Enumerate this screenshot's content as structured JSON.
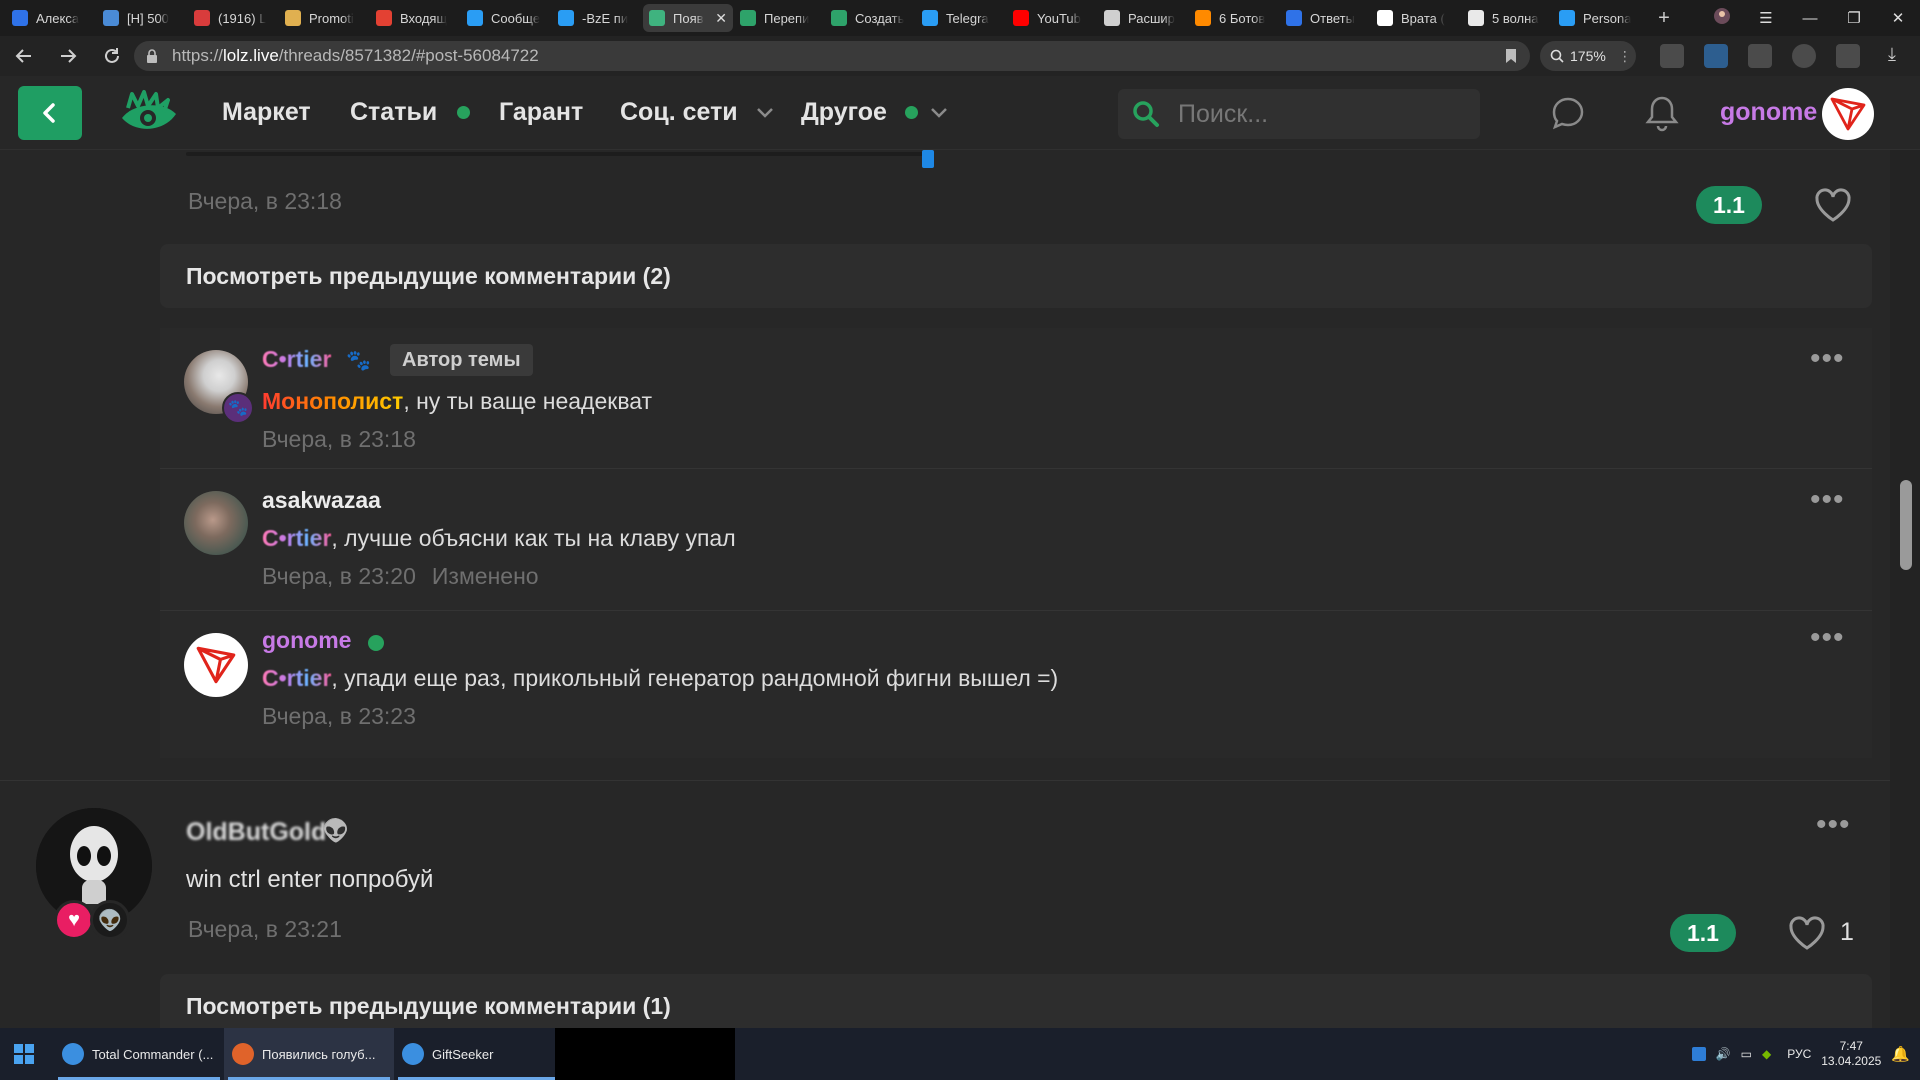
{
  "browser": {
    "tabs": [
      {
        "title": "Алекса",
        "color": "#2f72e8"
      },
      {
        "title": "[H] 500",
        "color": "#4a8bd6"
      },
      {
        "title": "(1916) L",
        "color": "#d93c3c"
      },
      {
        "title": "Promoti",
        "color": "#e0b050"
      },
      {
        "title": "Входящ",
        "color": "#e34133"
      },
      {
        "title": "Сообще",
        "color": "#2a9df4"
      },
      {
        "title": "-BzE пи",
        "color": "#2a9df4"
      },
      {
        "title": "Появ",
        "color": "#3fb37f",
        "active": true
      },
      {
        "title": "Перепи",
        "color": "#2ea36a"
      },
      {
        "title": "Создать",
        "color": "#2ea36a"
      },
      {
        "title": "Telegra",
        "color": "#2a9df4"
      },
      {
        "title": "YouTub",
        "color": "#ff0000"
      },
      {
        "title": "Расшир",
        "color": "#cfcfcf"
      },
      {
        "title": "6 Ботов",
        "color": "#ff8a00"
      },
      {
        "title": "Ответы",
        "color": "#2f72e8"
      },
      {
        "title": "Врата (",
        "color": "#ffffff"
      },
      {
        "title": "5 волна",
        "color": "#e9e9e9"
      },
      {
        "title": "Persona",
        "color": "#2a9df4"
      }
    ],
    "close_glyph": "✕",
    "new_tab_glyph": "+",
    "url_host": "lolz.live",
    "url_prefix": "https://",
    "url_path": "/threads/8571382/#post-56084722",
    "zoom": "175%"
  },
  "header": {
    "nav": {
      "market": "Маркет",
      "articles": "Статьи",
      "guarantor": "Гарант",
      "social": "Соц. сети",
      "other": "Другое"
    },
    "search_placeholder": "Поиск...",
    "username": "gonome"
  },
  "post1": {
    "timestamp": "Вчера, в 23:18",
    "rating": "1.1",
    "prev_comments": "Посмотреть предыдущие комментарии (2)",
    "comments": [
      {
        "name": "C•rtier",
        "badge": "Автор темы",
        "mention": "Монополист",
        "text": ", ну ты ваще неадекват",
        "timestamp": "Вчера, в 23:18",
        "edited": ""
      },
      {
        "name": "asakwazaa",
        "mention": "C•rtier",
        "text": ", лучше объясни как ты на клаву упал",
        "timestamp": "Вчера, в 23:20",
        "edited": "Изменено"
      },
      {
        "name": "gonome",
        "mention": "C•rtier",
        "text": ", упади еще раз, прикольный генератор рандомной фигни вышел =)",
        "timestamp": "Вчера, в 23:23",
        "edited": ""
      }
    ]
  },
  "post2": {
    "author": "OldButGold",
    "text": "win ctrl enter попробуй",
    "timestamp": "Вчера, в 23:21",
    "rating": "1.1",
    "likes": "1",
    "prev_comments": "Посмотреть предыдущие комментарии (1)"
  },
  "taskbar": {
    "apps": [
      {
        "label": "Total Commander (...",
        "color": "#3b8fe0"
      },
      {
        "label": "Появились голуб...",
        "color": "#e0632a",
        "active": true
      },
      {
        "label": "GiftSeeker",
        "color": "#3b8fe0"
      }
    ],
    "lang": "РУС",
    "time": "7:47",
    "date": "13.04.2025"
  },
  "colors": {
    "accent_green": "#1d8a5c",
    "username_purple": "#c77ae6",
    "link_blue": "#1e88e5"
  }
}
